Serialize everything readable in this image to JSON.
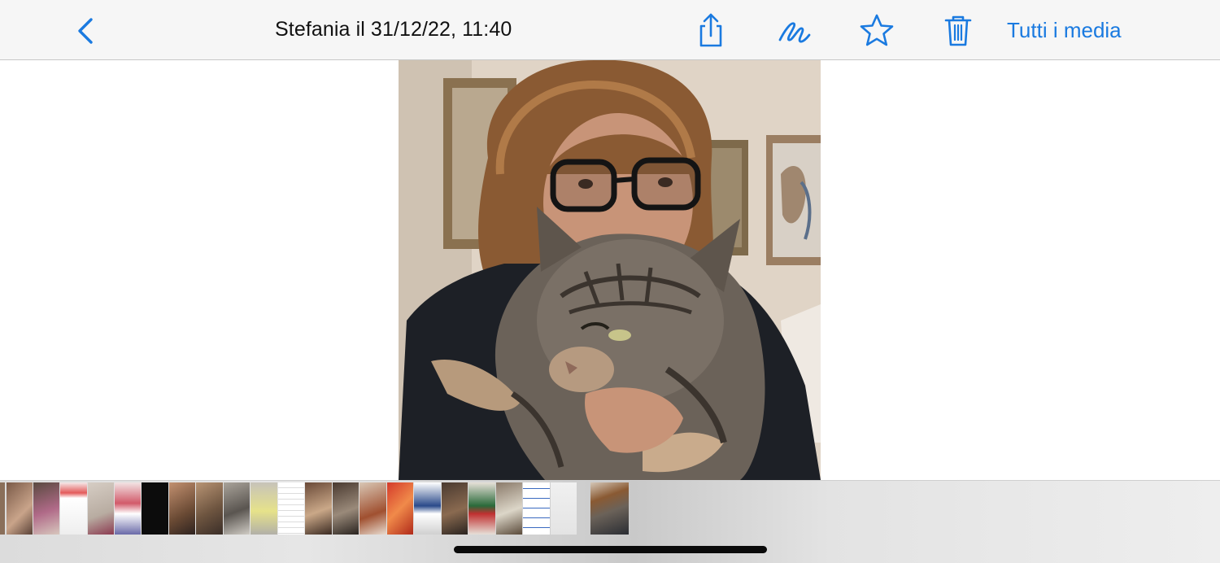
{
  "header": {
    "back_icon": "chevron-left-icon",
    "title": "Stefania il 31/12/22, 11:40",
    "tools": [
      "share-icon",
      "markup-icon",
      "star-icon",
      "trash-icon"
    ],
    "all_media_label": "Tutti i media"
  },
  "colors": {
    "accent": "#1a7ae0",
    "toolbar_bg": "#f6f6f6",
    "strip_bg": "#e0e0e0"
  },
  "photo": {
    "subject": "woman-with-glasses-holding-tabby-cat"
  },
  "thumbnails": {
    "count": 23,
    "selected_index": 22
  }
}
